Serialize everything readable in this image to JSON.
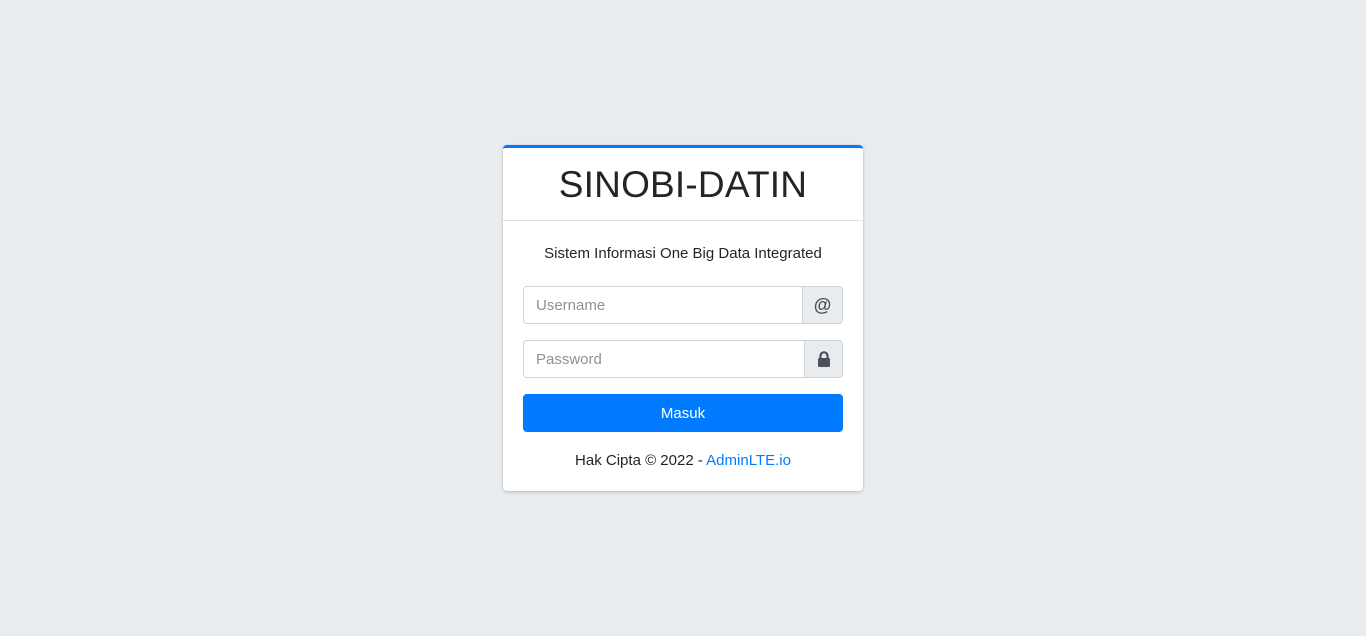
{
  "brand": {
    "title": "SINOBI-DATIN",
    "accent_color": "#007bff"
  },
  "login": {
    "subtitle": "Sistem Informasi One Big Data Integrated",
    "username": {
      "placeholder": "Username",
      "value": "",
      "icon": "at-icon",
      "icon_glyph": "@"
    },
    "password": {
      "placeholder": "Password",
      "value": "",
      "icon": "lock-icon"
    },
    "submit_label": "Masuk"
  },
  "footer": {
    "copyright_text": "Hak Cipta © 2022 - ",
    "link_text": "AdminLTE.io"
  },
  "colors": {
    "background": "#e9ecef",
    "primary": "#007bff",
    "addon_bg": "#e9ecef",
    "border": "#ced4da"
  }
}
